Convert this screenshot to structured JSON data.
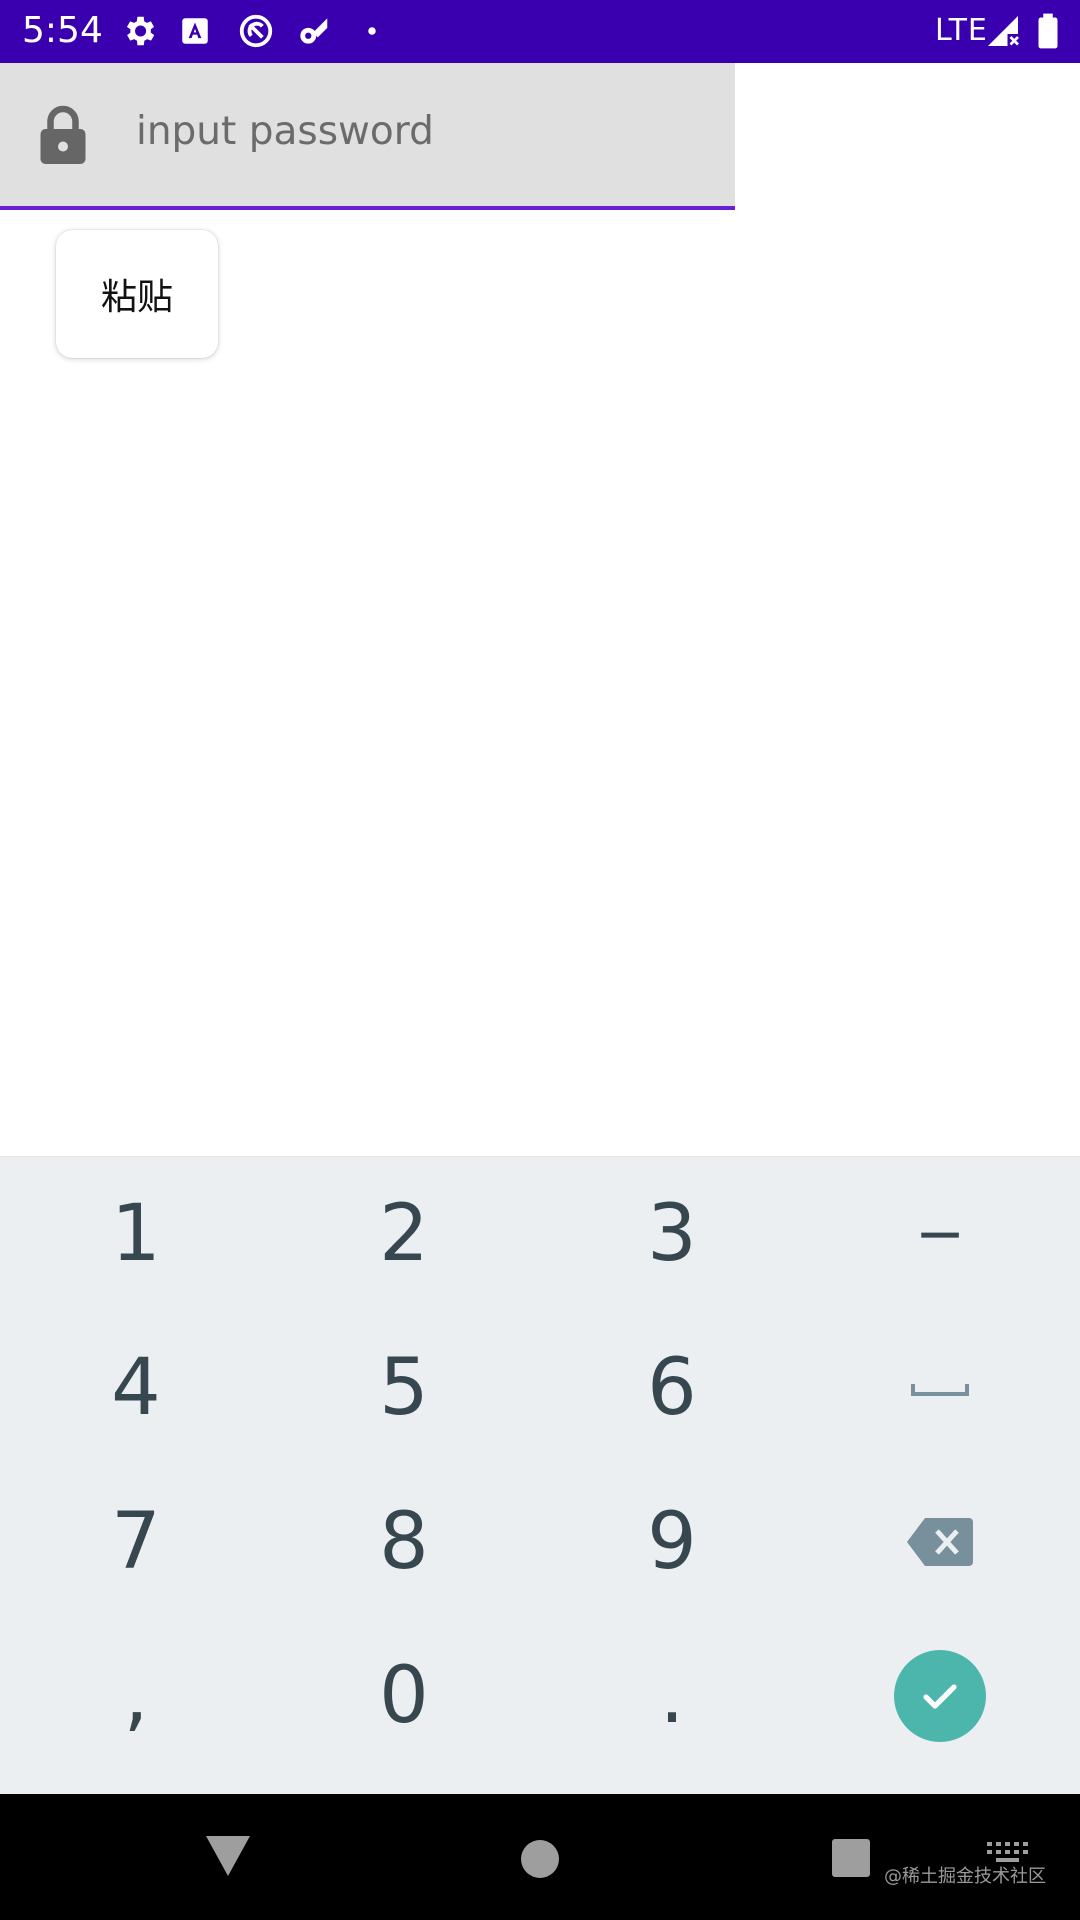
{
  "status_bar": {
    "time": "5:54",
    "network": "LTE",
    "background_color": "#3a00b0",
    "icons": [
      "settings-icon",
      "font-a-icon",
      "sync-circle-icon",
      "wifi-gear-icon",
      "dot-icon",
      "signal-icon",
      "battery-icon"
    ]
  },
  "password_field": {
    "placeholder": "input password",
    "value": "",
    "icon": "lock-icon",
    "underline_color": "#6a1fd6"
  },
  "popup": {
    "paste_label": "粘贴"
  },
  "keyboard": {
    "rows": [
      [
        "1",
        "2",
        "3",
        "−"
      ],
      [
        "4",
        "5",
        "6",
        "space"
      ],
      [
        "7",
        "8",
        "9",
        "backspace"
      ],
      [
        ",",
        "0",
        ".",
        "enter"
      ]
    ],
    "accent_color": "#4db6ac"
  },
  "nav_bar": {
    "buttons": [
      "back-icon",
      "home-icon",
      "recents-icon",
      "keyboard-switch-icon"
    ]
  },
  "watermark": "@稀土掘金技术社区"
}
